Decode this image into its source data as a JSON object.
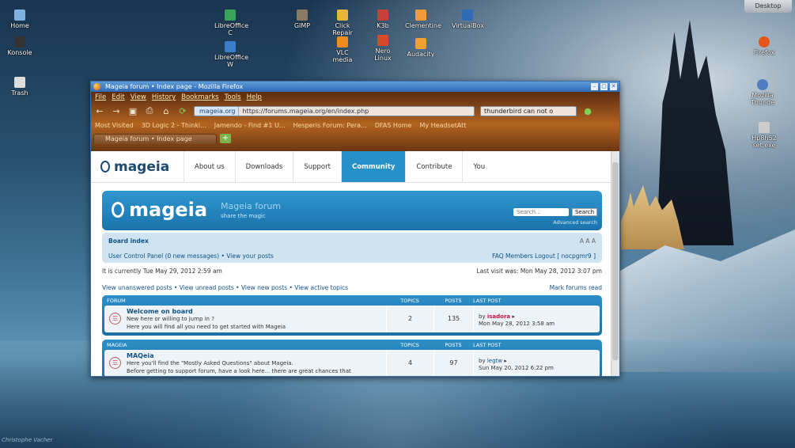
{
  "desktop": {
    "icons": [
      {
        "label": "Home",
        "icon": "home-folder-icon",
        "color": "#7fb0e0"
      },
      {
        "label": "Konsole",
        "icon": "terminal-icon",
        "color": "#333333"
      },
      {
        "label": "Trash",
        "icon": "trash-icon",
        "color": "#dddddd"
      },
      {
        "label": "LibreOffice C",
        "icon": "libreoffice-calc-icon",
        "color": "#3aa35b"
      },
      {
        "label": "LibreOffice W",
        "icon": "libreoffice-writer-icon",
        "color": "#3a7dc8"
      },
      {
        "label": "GIMP",
        "icon": "gimp-icon",
        "color": "#8a7a63"
      },
      {
        "label": "Click Repair",
        "icon": "click-repair-icon",
        "color": "#e7b53a"
      },
      {
        "label": "VLC media",
        "icon": "vlc-icon",
        "color": "#f08a1c"
      },
      {
        "label": "K3b",
        "icon": "k3b-icon",
        "color": "#c8403a"
      },
      {
        "label": "Nero Linux",
        "icon": "nero-icon",
        "color": "#d84a2a"
      },
      {
        "label": "Clementine",
        "icon": "clementine-icon",
        "color": "#f39b3c"
      },
      {
        "label": "Audacity",
        "icon": "audacity-icon",
        "color": "#f0a030"
      },
      {
        "label": "VirtualBox",
        "icon": "virtualbox-icon",
        "color": "#2f6bb3"
      },
      {
        "label": "Firefox",
        "icon": "firefox-icon",
        "color": "#e4561b"
      },
      {
        "label": "Mozilla Thunde",
        "icon": "thunderbird-icon",
        "color": "#4f7fc2"
      },
      {
        "label": "Hp8h52 set.exe",
        "icon": "exe-file-icon",
        "color": "#cccccc"
      }
    ],
    "desktop_tab": "Desktop",
    "credit": "Christophe Vacher"
  },
  "window": {
    "title": "Mageia forum • Index page - Mozilla Firefox",
    "menu": [
      "File",
      "Edit",
      "View",
      "History",
      "Bookmarks",
      "Tools",
      "Help"
    ],
    "url_site": "mageia.org",
    "url_path": "https://forums.mageia.org/en/index.php",
    "search_value": "thunderbird can not o",
    "bookmarks": [
      "Most Visited",
      "3D Logic 2 - Thinki...",
      "Jamendo - Find #1 U...",
      "Hesperis Forum: Pera...",
      "DFAS Home",
      "My HeadsetAtt"
    ],
    "tab_label": "Mageia forum • Index page"
  },
  "site": {
    "logo": "mageia",
    "nav": [
      "About us",
      "Downloads",
      "Support",
      "Community",
      "Contribute",
      "You"
    ],
    "active_nav": "Community"
  },
  "forum": {
    "logo": "mageia",
    "title": "Mageia forum",
    "tagline": "share the magic",
    "search_placeholder": "Search...",
    "search_button": "Search",
    "advanced_search": "Advanced search",
    "board_index": "Board index",
    "font_size": "A A A",
    "ucp": "User Control Panel (0 new messages) • View your posts",
    "user_links": "FAQ  Members  Logout [ nocpgmr9 ]",
    "current_time": "It is currently Tue May 29, 2012 2:59 am",
    "last_visit": "Last visit was: Mon May 28, 2012 3:07 pm",
    "quick_links": "View unanswered posts • View unread posts • View new posts • View active topics",
    "mark_read": "Mark forums read",
    "columns": [
      "FORUM",
      "TOPICS",
      "POSTS",
      "LAST POST"
    ],
    "categories": [
      {
        "name": "FORUM",
        "forum_title": "Welcome on board",
        "desc1": "New here or willing to jump in ?",
        "desc2": "Here you will find all you need to get started with Mageia",
        "topics": "2",
        "posts": "135",
        "last_by": "by",
        "last_user": "isadora",
        "last_date": "Mon May 28, 2012 3:58 am"
      },
      {
        "name": "MAGEIA",
        "forum_title": "MAQeia",
        "desc1": "Here you'll find the \"Mostly Asked Questions\" about Mageia.",
        "desc2": "Before getting to support forum, have a look here... there are great chances that",
        "topics": "4",
        "posts": "97",
        "last_by": "by",
        "last_user": "legtw",
        "last_date": "Sun May 20, 2012 6:22 pm"
      }
    ]
  }
}
